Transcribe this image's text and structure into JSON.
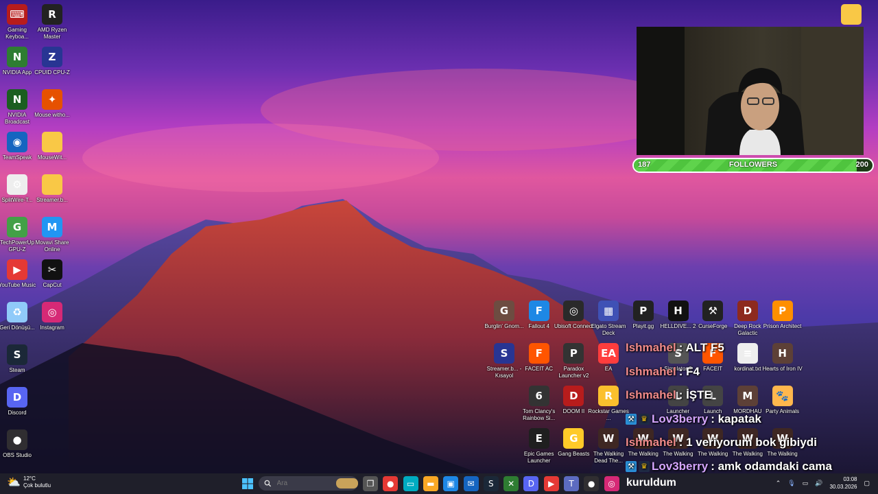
{
  "desktop_left": [
    {
      "label": "Gaming Keyboa...",
      "icon": "keyboard-icon",
      "color": "#b71c1c",
      "glyph": "⌨"
    },
    {
      "label": "AMD Ryzen Master",
      "icon": "ryzen-icon",
      "color": "#222222",
      "glyph": "R"
    },
    {
      "label": "NVIDIA App",
      "icon": "nvidia-icon",
      "color": "#2e7d32",
      "glyph": "N"
    },
    {
      "label": "CPUID CPU-Z",
      "icon": "cpuz-icon",
      "color": "#283593",
      "glyph": "Z"
    },
    {
      "label": "NVIDIA Broadcast",
      "icon": "nvidia-broadcast-icon",
      "color": "#1b5e20",
      "glyph": "N"
    },
    {
      "label": "Mouse witho...",
      "icon": "mouse-icon",
      "color": "#e65100",
      "glyph": "✦"
    },
    {
      "label": "TeamSpeak",
      "icon": "teamspeak-icon",
      "color": "#1565c0",
      "glyph": "◉"
    },
    {
      "label": "MouseWit...",
      "icon": "folder-icon",
      "color": "#f9c846",
      "glyph": ""
    },
    {
      "label": "SplitWire-T...",
      "icon": "splitwire-icon",
      "color": "#eeeeee",
      "glyph": "⚙"
    },
    {
      "label": "Streamer.b...",
      "icon": "folder-icon",
      "color": "#f9c846",
      "glyph": ""
    },
    {
      "label": "TechPowerUp GPU-Z",
      "icon": "gpuz-icon",
      "color": "#43a047",
      "glyph": "G"
    },
    {
      "label": "Movavi Share Online",
      "icon": "movavi-icon",
      "color": "#2196f3",
      "glyph": "M"
    },
    {
      "label": "YouTube Music",
      "icon": "youtube-music-icon",
      "color": "#e53935",
      "glyph": "▶"
    },
    {
      "label": "CapCut",
      "icon": "capcut-icon",
      "color": "#111111",
      "glyph": "✂"
    },
    {
      "label": "Geri Dönüşü...",
      "icon": "recycle-bin-icon",
      "color": "#90caf9",
      "glyph": "♻"
    },
    {
      "label": "Instagram",
      "icon": "instagram-icon",
      "color": "#d62976",
      "glyph": "◎"
    },
    {
      "label": "Steam",
      "icon": "steam-icon",
      "color": "#1b2838",
      "glyph": "S"
    },
    {
      "label": "Discord",
      "icon": "discord-icon",
      "color": "#5865f2",
      "glyph": "D"
    },
    {
      "label": "OBS Studio",
      "icon": "obs-icon",
      "color": "#302e31",
      "glyph": "●"
    }
  ],
  "desktop_right": [
    {
      "label": "Burglin' Gnom...",
      "icon": "burglin-gnomes-icon",
      "color": "#6d4c41",
      "glyph": "G"
    },
    {
      "label": "Fallout 4",
      "icon": "fallout4-icon",
      "color": "#1e88e5",
      "glyph": "F"
    },
    {
      "label": "Ubisoft Connect",
      "icon": "ubisoft-icon",
      "color": "#2a2a2a",
      "glyph": "◎"
    },
    {
      "label": "Elgato Stream Deck",
      "icon": "stream-deck-icon",
      "color": "#3f51b5",
      "glyph": "▦"
    },
    {
      "label": "Playit.gg",
      "icon": "playit-icon",
      "color": "#222222",
      "glyph": "P"
    },
    {
      "label": "HELLDIVE... 2",
      "icon": "helldivers-icon",
      "color": "#111111",
      "glyph": "H"
    },
    {
      "label": "CurseForge",
      "icon": "curseforge-icon",
      "color": "#222222",
      "glyph": "⚒"
    },
    {
      "label": "Deep Rock Galactic",
      "icon": "deep-rock-icon",
      "color": "#8d2a1e",
      "glyph": "D"
    },
    {
      "label": "Prison Architect",
      "icon": "prison-architect-icon",
      "color": "#ff8f00",
      "glyph": "P"
    },
    {
      "label": "Streamer.b... - Kısayol",
      "icon": "streamerbot-icon",
      "color": "#283593",
      "glyph": "S"
    },
    {
      "label": "FACEIT AC",
      "icon": "faceit-icon",
      "color": "#ff5500",
      "glyph": "F"
    },
    {
      "label": "Paradox Launcher v2",
      "icon": "paradox-icon",
      "color": "#333333",
      "glyph": "P"
    },
    {
      "label": "EA",
      "icon": "ea-icon",
      "color": "#ff3d3d",
      "glyph": "EA"
    },
    {
      "label": "Simulator 2",
      "icon": "simulator-icon",
      "color": "#555555",
      "glyph": "S"
    },
    {
      "label": "FACEIT",
      "icon": "faceit2-icon",
      "color": "#ff5500",
      "glyph": "F"
    },
    {
      "label": "kordinat.txt",
      "icon": "text-file-icon",
      "color": "#eeeeee",
      "glyph": "≡"
    },
    {
      "label": "Hearts of Iron IV",
      "icon": "hoi4-icon",
      "color": "#5d4037",
      "glyph": "H"
    },
    {
      "label": "Tom Clancy's Rainbow Si...",
      "icon": "rainbow-six-icon",
      "color": "#333333",
      "glyph": "6"
    },
    {
      "label": "DOOM II",
      "icon": "doom-icon",
      "color": "#b71c1c",
      "glyph": "D"
    },
    {
      "label": "Rockstar Games ...",
      "icon": "rockstar-icon",
      "color": "#fbc02d",
      "glyph": "R"
    },
    {
      "label": "Launcher",
      "icon": "launcher-icon",
      "color": "#444444",
      "glyph": "L"
    },
    {
      "label": "Launch",
      "icon": "launch-icon",
      "color": "#444444",
      "glyph": "L"
    },
    {
      "label": "MORDHAU",
      "icon": "mordhau-icon",
      "color": "#5d4037",
      "glyph": "M"
    },
    {
      "label": "Party Animals",
      "icon": "party-animals-icon",
      "color": "#ffb74d",
      "glyph": "🐾"
    },
    {
      "label": "Epic Games Launcher",
      "icon": "epic-games-icon",
      "color": "#1f1f1f",
      "glyph": "E"
    },
    {
      "label": "Gang Beasts",
      "icon": "gang-beasts-icon",
      "color": "#ffca28",
      "glyph": "G"
    },
    {
      "label": "The Walking Dead The...",
      "icon": "twd-icon",
      "color": "#3e2723",
      "glyph": "W"
    },
    {
      "label": "The Walking",
      "icon": "twd-icon",
      "color": "#3e2723",
      "glyph": "W"
    },
    {
      "label": "The Walking",
      "icon": "twd-icon",
      "color": "#3e2723",
      "glyph": "W"
    },
    {
      "label": "The Walking",
      "icon": "twd-icon",
      "color": "#3e2723",
      "glyph": "W"
    },
    {
      "label": "The Walking",
      "icon": "twd-icon",
      "color": "#3e2723",
      "glyph": "W"
    },
    {
      "label": "The Walking",
      "icon": "twd-icon",
      "color": "#3e2723",
      "glyph": "W"
    }
  ],
  "top_right_folder": {
    "label": "",
    "icon": "folder-icon"
  },
  "followers": {
    "current": "187",
    "label": "FOLLOWERS",
    "goal": "200",
    "progress": 0.935
  },
  "chat": [
    {
      "user": "Ishmahel",
      "color": "#f08a8a",
      "badges": [],
      "text": ": ALT F5"
    },
    {
      "user": "Ishmahel",
      "color": "#f08a8a",
      "badges": [],
      "text": ": F4"
    },
    {
      "user": "Ishmahel",
      "color": "#f08a8a",
      "badges": [],
      "text": ": İŞTE"
    },
    {
      "user": "Lov3berry",
      "color": "#d5a6ff",
      "badges": [
        "pickaxe",
        "crown"
      ],
      "text": ": kapatak"
    },
    {
      "user": "Ishmahel",
      "color": "#f08a8a",
      "badges": [],
      "text": ": 1 veriyorum bok gibiydi"
    },
    {
      "user": "Lov3berry",
      "color": "#d5a6ff",
      "badges": [
        "pickaxe",
        "crown"
      ],
      "text": ": amk odamdaki cama"
    }
  ],
  "taskbar": {
    "weather_temp": "12°C",
    "weather_desc": "Çok bulutlu",
    "search_placeholder": "Ara",
    "apps": [
      {
        "icon": "task-view-icon",
        "color": "#555555",
        "glyph": "❐"
      },
      {
        "icon": "chrome-icon",
        "color": "#e53935",
        "glyph": "●"
      },
      {
        "icon": "monitor-icon",
        "color": "#00acc1",
        "glyph": "▭"
      },
      {
        "icon": "file-explorer-icon",
        "color": "#f9a825",
        "glyph": "▬"
      },
      {
        "icon": "store-icon",
        "color": "#1e88e5",
        "glyph": "▣"
      },
      {
        "icon": "mail-icon",
        "color": "#1565c0",
        "glyph": "✉"
      },
      {
        "icon": "steam-icon",
        "color": "#1b2838",
        "glyph": "S"
      },
      {
        "icon": "xbox-icon",
        "color": "#2e7d32",
        "glyph": "✕"
      },
      {
        "icon": "discord-icon",
        "color": "#5865f2",
        "glyph": "D"
      },
      {
        "icon": "youtube-music-icon",
        "color": "#e53935",
        "glyph": "▶"
      },
      {
        "icon": "teams-icon",
        "color": "#5c6bc0",
        "glyph": "T"
      },
      {
        "icon": "obs-icon",
        "color": "#302e31",
        "glyph": "●"
      },
      {
        "icon": "instagram-icon",
        "color": "#d62976",
        "glyph": "◎"
      }
    ],
    "active_window_title": "kuruldum",
    "time": "03:08",
    "date": "30.03.2026"
  }
}
